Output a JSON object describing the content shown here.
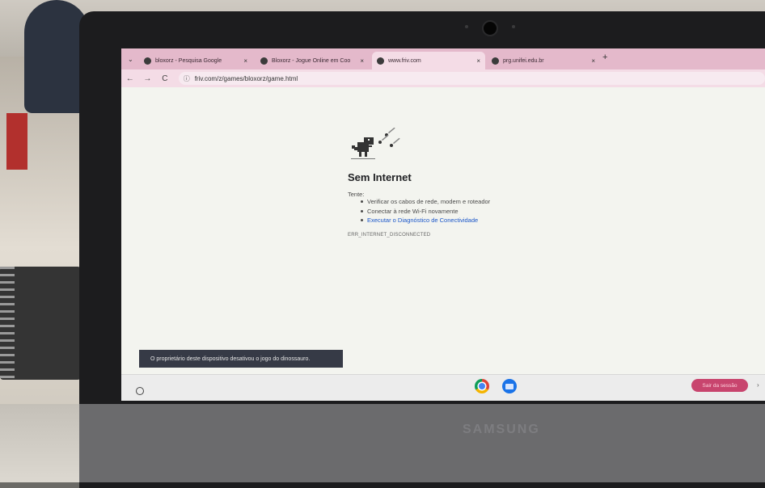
{
  "browser": {
    "tabs": [
      {
        "title": "bloxorz - Pesquisa Google",
        "active": false
      },
      {
        "title": "Bloxorz - Jogue Online em Coo",
        "active": false
      },
      {
        "title": "www.friv.com",
        "active": true
      },
      {
        "title": "prg.unifei.edu.br",
        "active": false
      }
    ],
    "tab_close_glyph": "×",
    "new_tab_glyph": "+",
    "menu_glyph": "⌄",
    "back_glyph": "←",
    "forward_glyph": "→",
    "reload_glyph": "C",
    "site_info_glyph": "ⓘ",
    "url": "friv.com/z/games/bloxorz/game.html"
  },
  "error_page": {
    "title": "Sem Internet",
    "try_label": "Tente:",
    "suggestions": [
      "Verificar os cabos de rede, modem e roteador",
      "Conectar à rede Wi-Fi novamente",
      "Executar o Diagnóstico de Conectividade"
    ],
    "error_code": "ERR_INTERNET_DISCONNECTED"
  },
  "toast": {
    "message": "O proprietário deste dispositivo desativou o jogo do dinossauro."
  },
  "shelf": {
    "logout_label": "Sair da sessão",
    "chevron_glyph": "›"
  },
  "device": {
    "brand": "SAMSUNG"
  },
  "colors": {
    "tabstrip": "#e4b9cb",
    "toolbar": "#f4dce6",
    "link": "#1a56c9",
    "logout": "#c8456e",
    "toast": "#363a46"
  }
}
